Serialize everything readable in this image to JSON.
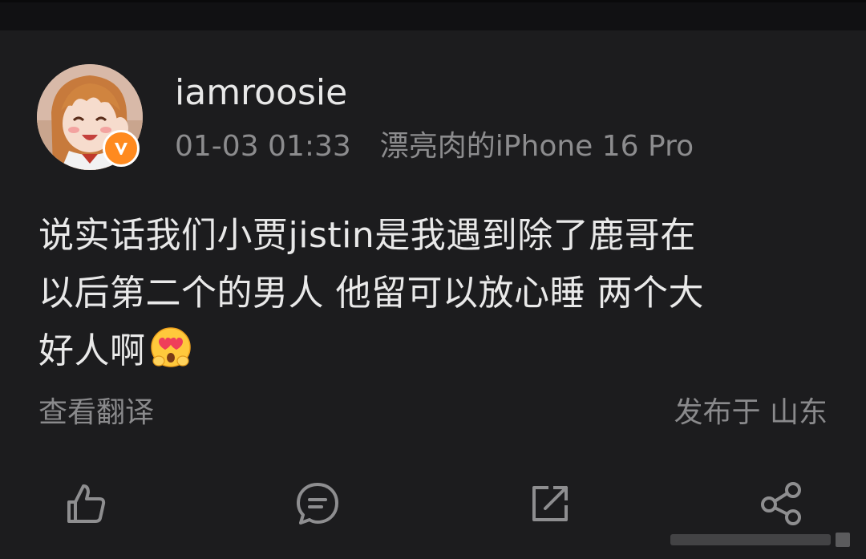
{
  "post": {
    "username": "iamroosie",
    "timestamp": "01-03 01:33",
    "device": "漂亮肉的iPhone 16 Pro",
    "text_lines": [
      "说实话我们小贾jistin是我遇到除了鹿哥在",
      "以后第二个的男人 他留可以放心睡 两个大",
      "好人啊"
    ],
    "emoji": "heart-eyes-face-emoji",
    "translate_label": "查看翻译",
    "location": "发布于 山东",
    "verified": true
  },
  "actions": [
    {
      "name": "like",
      "icon": "thumbs-up-icon"
    },
    {
      "name": "comment",
      "icon": "comment-bubble-icon"
    },
    {
      "name": "repost",
      "icon": "repost-icon"
    },
    {
      "name": "share",
      "icon": "share-icon"
    }
  ],
  "colors": {
    "background": "#1c1c1e",
    "text": "#e9e9e9",
    "muted": "#8c8c8e",
    "badge": "#ff8a1f"
  }
}
